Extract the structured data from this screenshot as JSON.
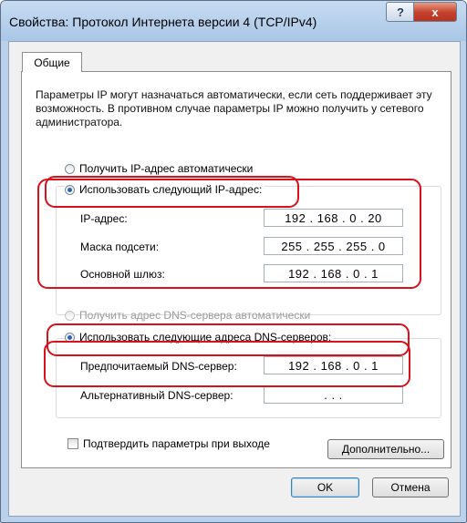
{
  "window": {
    "title": "Свойства: Протокол Интернета версии 4 (TCP/IPv4)",
    "help_label": "?",
    "close_label": "x"
  },
  "tabs": [
    {
      "label": "Общие",
      "active": true
    }
  ],
  "description": "Параметры IP могут назначаться автоматически, если сеть поддерживает эту возможность. В противном случае параметры IP можно получить у сетевого администратора.",
  "ip": {
    "auto_label": "Получить IP-адрес автоматически",
    "manual_label": "Использовать следующий IP-адрес:",
    "selected": "manual",
    "fields": {
      "address_label": "IP-адрес:",
      "address_value": "192 . 168 .  0  . 20",
      "mask_label": "Маска подсети:",
      "mask_value": "255 . 255 . 255 .  0",
      "gateway_label": "Основной шлюз:",
      "gateway_value": "192 . 168 .  0  .  1"
    }
  },
  "dns": {
    "auto_label": "Получить адрес DNS-сервера автоматически",
    "manual_label": "Использовать следующие адреса DNS-серверов:",
    "selected": "manual",
    "preferred_label": "Предпочитаемый DNS-сервер:",
    "preferred_value": "192 . 168 .  0  .  1",
    "alternate_label": "Альтернативный DNS-сервер:",
    "alternate_value": ".      .      ."
  },
  "validate_label": "Подтвердить параметры при выходе",
  "validate_checked": false,
  "buttons": {
    "advanced": "Дополнительно...",
    "ok": "OK",
    "cancel": "Отмена"
  },
  "highlight_color": "#d8111b",
  "accent_color": "#2b66b5"
}
